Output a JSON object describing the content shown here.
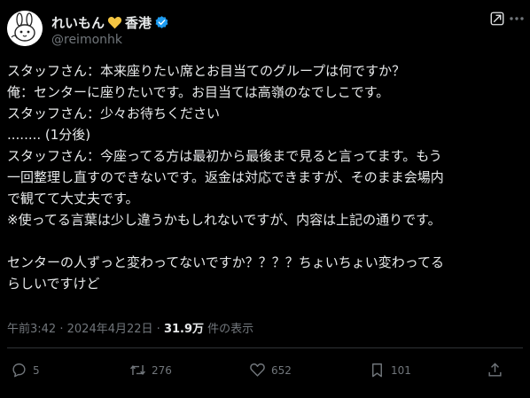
{
  "user": {
    "display_name": "れいもん",
    "display_name_suffix": "香港",
    "handle": "@reimonhk",
    "avatar_icon": "bunny-avatar-icon",
    "heart_color": "#f4c542",
    "verified_color": "#1d9bf0"
  },
  "tweet": {
    "lines": [
      "スタッフさん：本来座りたい席とお目当てのグループは何ですか？",
      "俺：センターに座りたいです。お目当ては高嶺のなでしこです。",
      "スタッフさん：少々お待ちください",
      "........ (1分後)",
      "スタッフさん：今座ってる方は最初から最後まで見ると言ってます。もう",
      "一回整理し直すのできないです。返金は対応できますが、そのまま会場内",
      "で観てて大丈夫です。",
      "※使ってる言葉は少し違うかもしれないですが、内容は上記の通りです。",
      "",
      "センターの人ずっと変わってないですか？？？？ちょいちょい変わってる",
      "らしいですけど"
    ]
  },
  "meta": {
    "time": "午前3:42",
    "separator": "·",
    "date": "2024年4月22日",
    "views_count": "31.9万",
    "views_label": "件の表示"
  },
  "actions": {
    "replies": "5",
    "retweets": "276",
    "likes": "652",
    "bookmarks": "101"
  }
}
